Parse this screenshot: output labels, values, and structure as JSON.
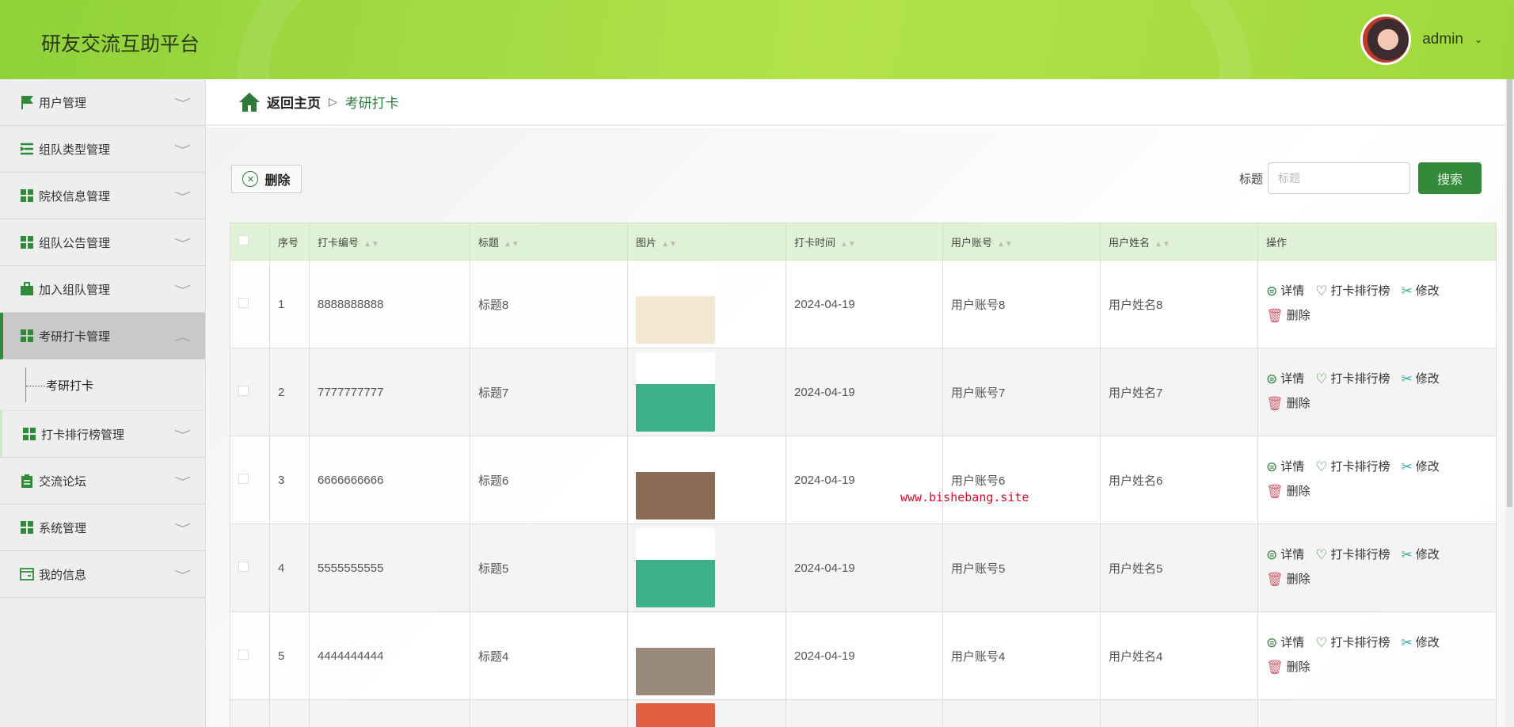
{
  "header": {
    "title": "研友交流互助平台",
    "user": "admin"
  },
  "sidebar": {
    "items": [
      {
        "label": "用户管理",
        "icon": "flag-icon"
      },
      {
        "label": "组队类型管理",
        "icon": "list-icon"
      },
      {
        "label": "院校信息管理",
        "icon": "grid-icon"
      },
      {
        "label": "组队公告管理",
        "icon": "grid-icon"
      },
      {
        "label": "加入组队管理",
        "icon": "briefcase-icon"
      },
      {
        "label": "考研打卡管理",
        "icon": "grid-icon",
        "sub": "考研打卡"
      },
      {
        "label": "打卡排行榜管理",
        "icon": "grid-icon"
      },
      {
        "label": "交流论坛",
        "icon": "clipboard-icon"
      },
      {
        "label": "系统管理",
        "icon": "grid-icon"
      },
      {
        "label": "我的信息",
        "icon": "card-icon"
      }
    ]
  },
  "breadcrumb": {
    "home": "返回主页",
    "sep": "▷",
    "current": "考研打卡"
  },
  "toolbar": {
    "delete": "删除",
    "search_label": "标题",
    "search_placeholder": "标题",
    "search_button": "搜索"
  },
  "table": {
    "headers": [
      "序号",
      "打卡编号",
      "标题",
      "图片",
      "打卡时间",
      "用户账号",
      "用户姓名",
      "操作"
    ],
    "actions": {
      "detail": "详情",
      "rank": "打卡排行榜",
      "edit": "修改",
      "delete": "删除"
    },
    "rows": [
      {
        "idx": "1",
        "code": "8888888888",
        "title": "标题8",
        "time": "2024-04-19",
        "account": "用户账号8",
        "name": "用户姓名8",
        "pic": "#f5e8d2"
      },
      {
        "idx": "2",
        "code": "7777777777",
        "title": "标题7",
        "time": "2024-04-19",
        "account": "用户账号7",
        "name": "用户姓名7",
        "pic": "#3bb08a"
      },
      {
        "idx": "3",
        "code": "6666666666",
        "title": "标题6",
        "time": "2024-04-19",
        "account": "用户账号6",
        "name": "用户姓名6",
        "pic": "#8a6a55"
      },
      {
        "idx": "4",
        "code": "5555555555",
        "title": "标题5",
        "time": "2024-04-19",
        "account": "用户账号5",
        "name": "用户姓名5",
        "pic": "#3bb08a"
      },
      {
        "idx": "5",
        "code": "4444444444",
        "title": "标题4",
        "time": "2024-04-19",
        "account": "用户账号4",
        "name": "用户姓名4",
        "pic": "#9a8a7a"
      }
    ]
  },
  "watermark": "www.bishebang.site"
}
